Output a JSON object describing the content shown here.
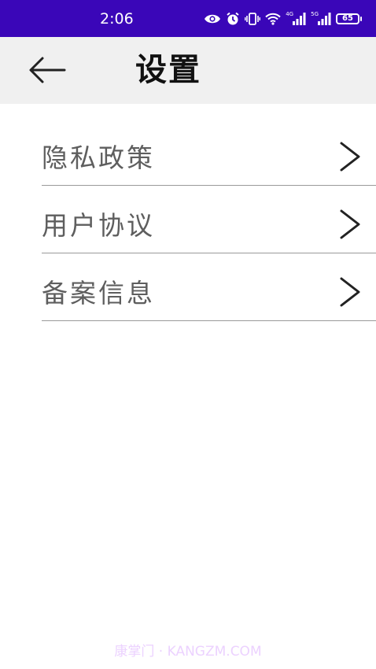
{
  "status_bar": {
    "time": "2:06",
    "signal_4g": "4G",
    "signal_5g": "5G",
    "battery_level": "65",
    "background_color": "#3a06b8"
  },
  "app_bar": {
    "back_icon": "arrow-left-icon",
    "title": "设置",
    "background_color": "#f0f0f0"
  },
  "menu": {
    "items": [
      {
        "label": "隐私政策",
        "icon": "chevron-right-icon"
      },
      {
        "label": "用户协议",
        "icon": "chevron-right-icon"
      },
      {
        "label": "备案信息",
        "icon": "chevron-right-icon"
      }
    ],
    "label_color": "#5e5e5e",
    "divider_color": "#9a9a9a"
  },
  "watermark": {
    "text": "康掌门 · KANGZM.COM"
  }
}
